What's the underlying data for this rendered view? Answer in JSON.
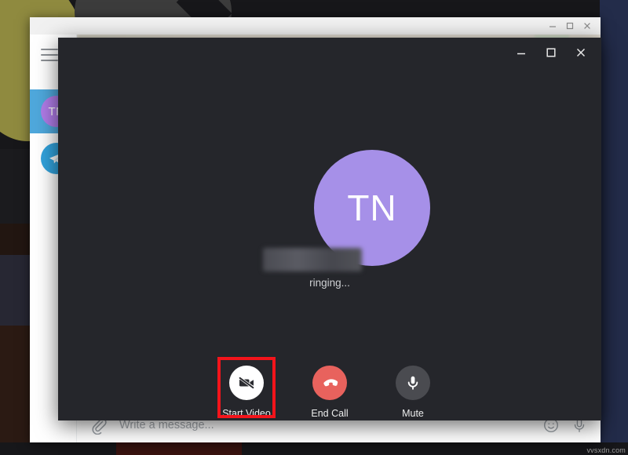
{
  "desktop": {
    "watermark": "vvsxdn.com"
  },
  "app_window": {
    "title_controls": [
      {
        "name": "minimize",
        "glyph": "minimize-icon"
      },
      {
        "name": "maximize",
        "glyph": "maximize-icon"
      },
      {
        "name": "close",
        "glyph": "close-icon"
      }
    ],
    "sidebar": {
      "menu_icon": "hamburger-menu-icon",
      "chat_items": [
        {
          "initials": "TN",
          "selected": true,
          "avatar_color": "#b07ce8",
          "row_color": "#4fa8dc"
        }
      ],
      "app_logo": "telegram-logo-icon"
    },
    "input_bar": {
      "attach_icon": "paperclip-icon",
      "placeholder": "Write a message...",
      "value": "",
      "emoji_icon": "smiley-icon",
      "voice_icon": "microphone-icon"
    },
    "overflow_menu_icon": "more-vertical-icon"
  },
  "call_window": {
    "title_controls": [
      {
        "name": "minimize",
        "glyph": "minimize-icon"
      },
      {
        "name": "maximize",
        "glyph": "maximize-icon"
      },
      {
        "name": "close",
        "glyph": "close-icon"
      }
    ],
    "avatar_initials": "TN",
    "avatar_color": "#a690e8",
    "contact_name": "",
    "status": "ringing...",
    "controls": [
      {
        "id": "start-video",
        "label": "Start Video",
        "icon": "video-off-icon",
        "circle_color": "#ffffff",
        "highlighted": true
      },
      {
        "id": "end-call",
        "label": "End Call",
        "icon": "phone-hangup-icon",
        "circle_color": "#e8625d",
        "highlighted": false
      },
      {
        "id": "mute",
        "label": "Mute",
        "icon": "microphone-icon",
        "circle_color": "#4a4b50",
        "highlighted": false
      }
    ],
    "highlight_color": "#f3141b"
  }
}
